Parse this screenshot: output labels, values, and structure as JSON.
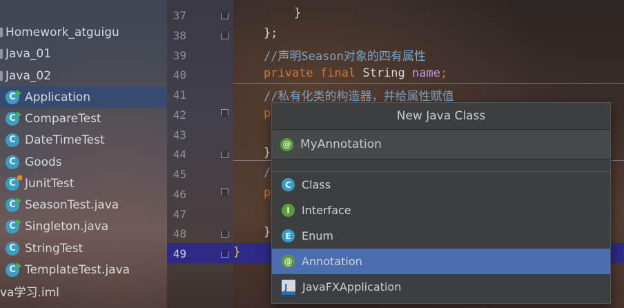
{
  "project_tree": {
    "items": [
      {
        "label": "Homework_atguigu",
        "kind": "folder"
      },
      {
        "label": "Java_01",
        "kind": "folder"
      },
      {
        "label": "Java_02",
        "kind": "folder"
      },
      {
        "label": "Application",
        "kind": "class-run",
        "selected": true
      },
      {
        "label": "CompareTest",
        "kind": "class-run"
      },
      {
        "label": "DateTimeTest",
        "kind": "class"
      },
      {
        "label": "Goods",
        "kind": "class"
      },
      {
        "label": "JunitTest",
        "kind": "class-lock"
      },
      {
        "label": "SeasonTest.java",
        "kind": "class-run"
      },
      {
        "label": "Singleton.java",
        "kind": "class-run"
      },
      {
        "label": "StringTest",
        "kind": "class"
      },
      {
        "label": "TemplateTest.java",
        "kind": "class-run"
      },
      {
        "label": "va学习.iml",
        "kind": "file"
      }
    ]
  },
  "editor": {
    "line_numbers": [
      "37",
      "38",
      "39",
      "40",
      "41",
      "42",
      "43",
      "44",
      "45",
      "46",
      "47",
      "48",
      "49"
    ],
    "active_line": "49",
    "lines": {
      "l37": "}",
      "l38": "};",
      "l39_comment": "//声明Season对象的四有属性",
      "l40_private": "private",
      "l40_final": "final",
      "l40_type": "String",
      "l40_field": "name",
      "l40_semi": ";",
      "l41_comment": "//私有化类的构造器，并给属性赋值",
      "l42": "p",
      "l44": "}",
      "l45": "/",
      "l46": "p",
      "l48": "}",
      "l49": "}"
    }
  },
  "popup": {
    "title": "New Java Class",
    "input_value": "MyAnnotation",
    "items": [
      {
        "label": "Class",
        "icon": "class-icon",
        "letter": "C"
      },
      {
        "label": "Interface",
        "icon": "interface-icon",
        "letter": "I"
      },
      {
        "label": "Enum",
        "icon": "enum-icon",
        "letter": "E"
      },
      {
        "label": "Annotation",
        "icon": "annotation-icon",
        "letter": "@",
        "selected": true
      },
      {
        "label": "JavaFXApplication",
        "icon": "javafx-icon",
        "letter": ""
      }
    ],
    "input_icon_letter": "@"
  },
  "colors": {
    "selection": "#4b6eaf",
    "current_line": "#2d2a88",
    "keyword": "#cc7832",
    "comment": "#7fa4c4"
  }
}
